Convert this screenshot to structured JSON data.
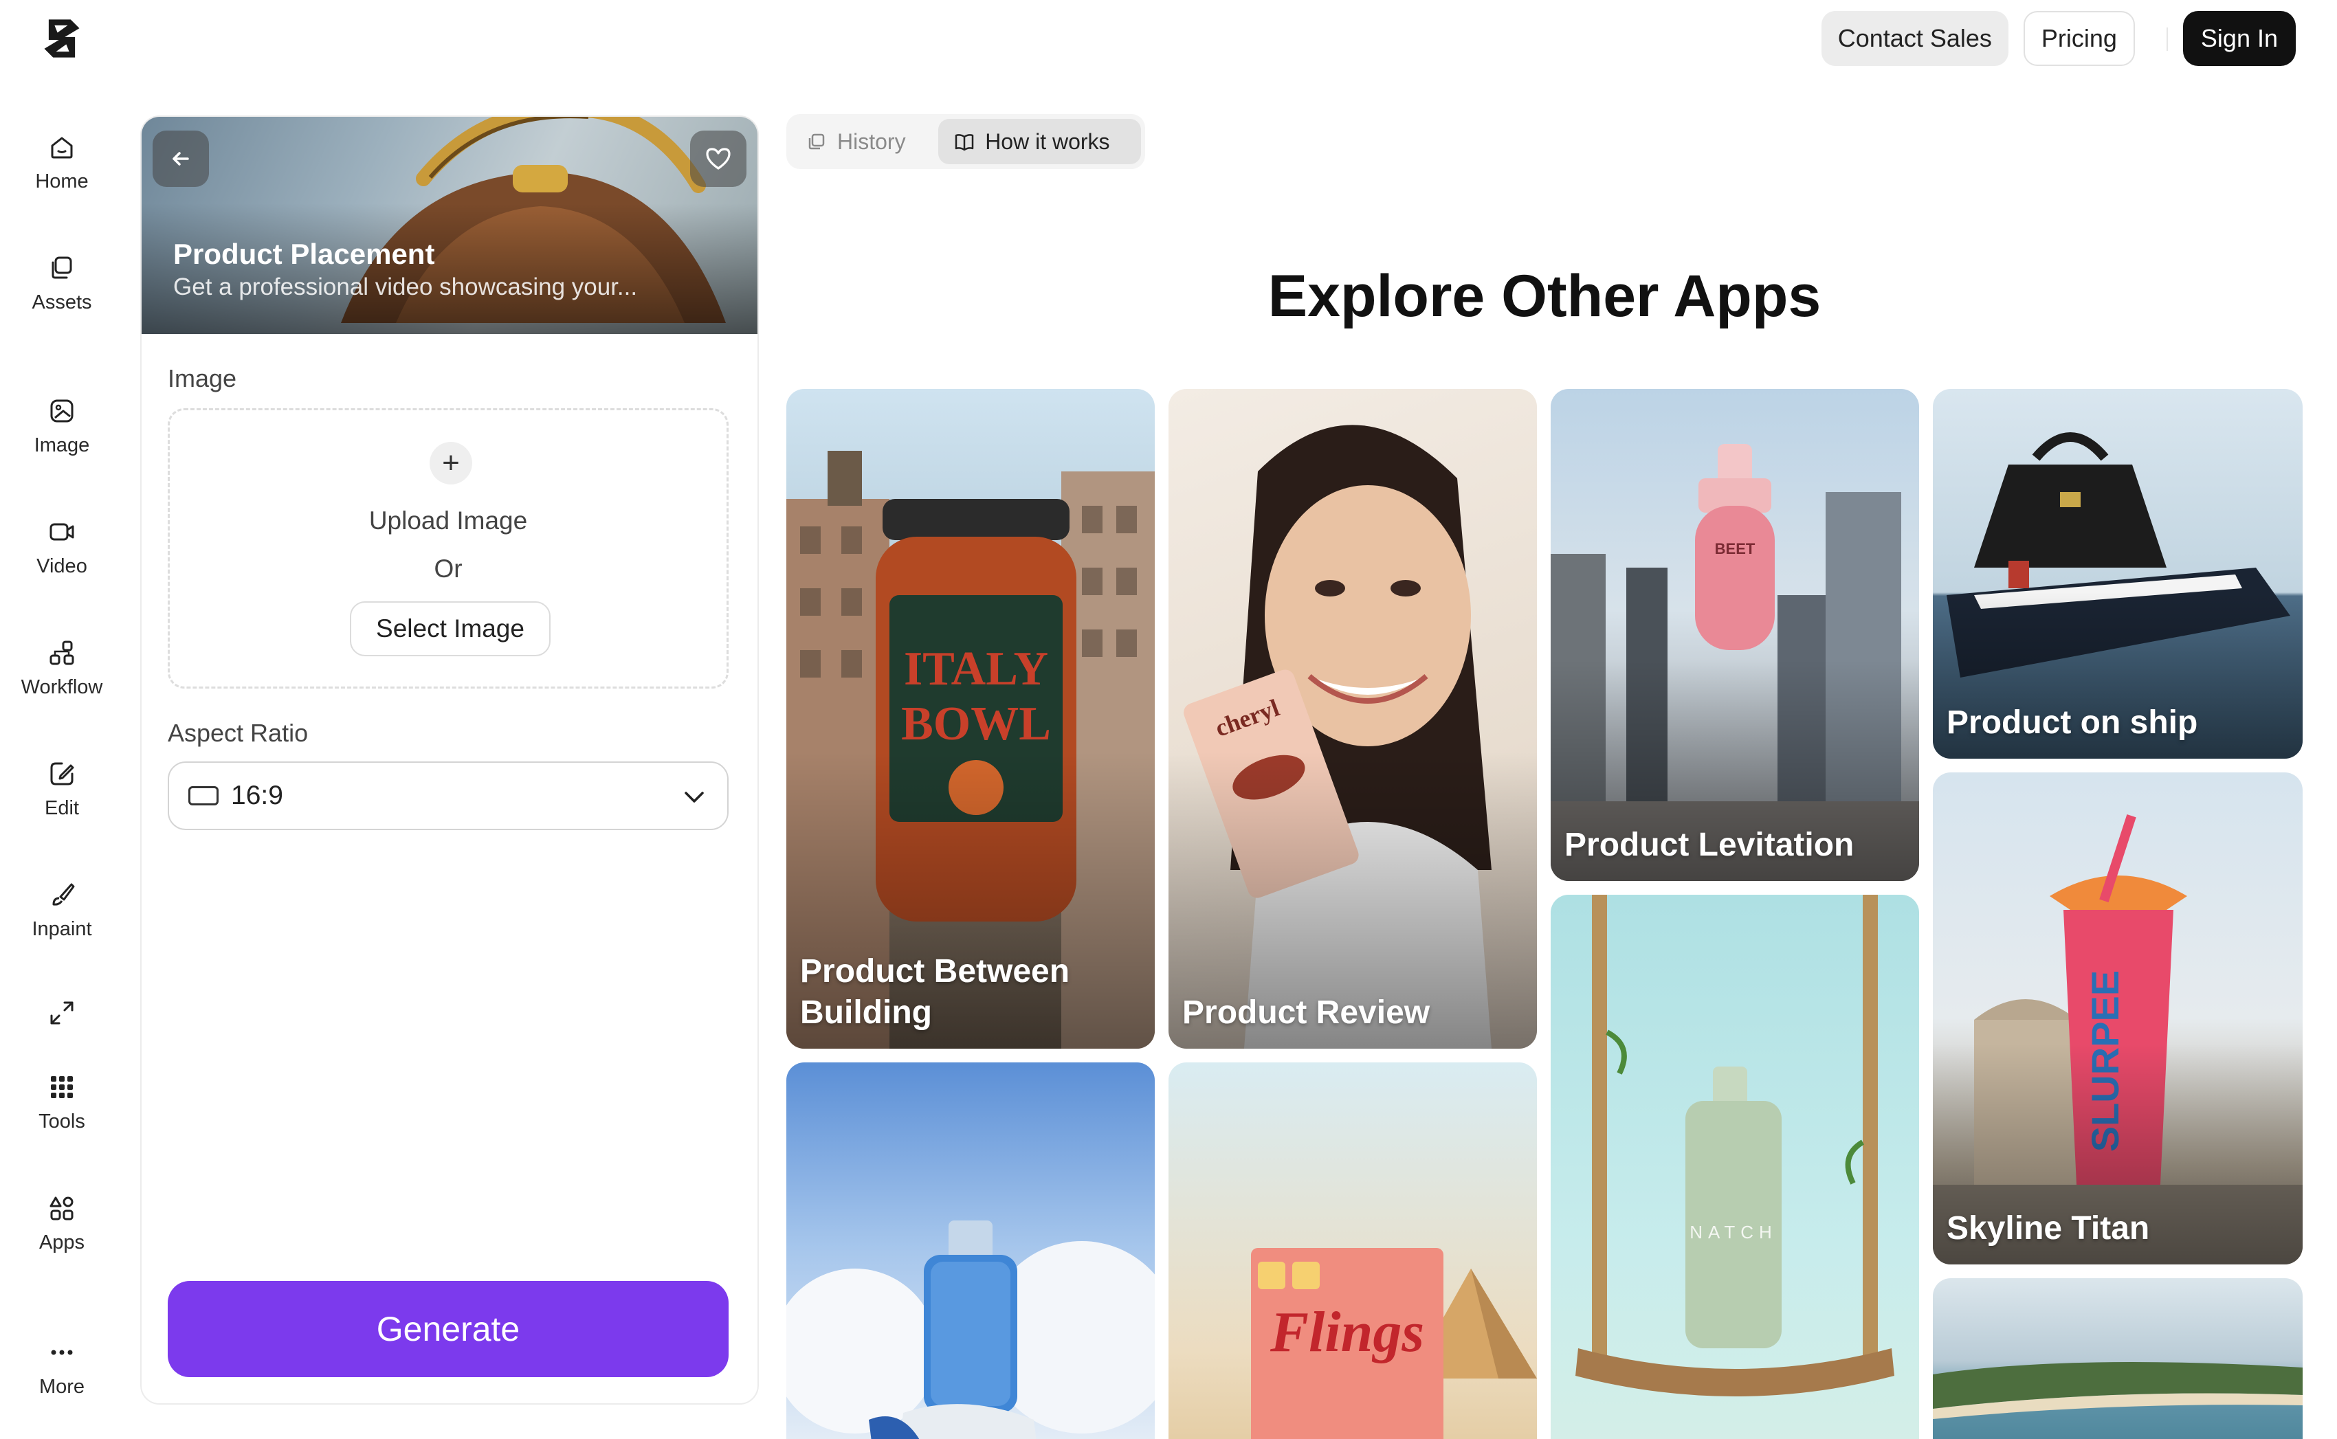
{
  "header": {
    "contact_sales": "Contact Sales",
    "pricing": "Pricing",
    "sign_in": "Sign In"
  },
  "nav": {
    "items": [
      {
        "label": "Home",
        "icon": "home-icon"
      },
      {
        "label": "Assets",
        "icon": "assets-icon"
      },
      {
        "label": "Image",
        "icon": "image-icon"
      },
      {
        "label": "Video",
        "icon": "video-icon"
      },
      {
        "label": "Workflow",
        "icon": "workflow-icon"
      },
      {
        "label": "Edit",
        "icon": "edit-icon"
      },
      {
        "label": "Inpaint",
        "icon": "brush-icon"
      },
      {
        "label": "",
        "icon": "expand-icon"
      },
      {
        "label": "Tools",
        "icon": "grid-icon"
      },
      {
        "label": "Apps",
        "icon": "apps-icon"
      },
      {
        "label": "More",
        "icon": "more-icon"
      }
    ]
  },
  "panel": {
    "title": "Product Placement",
    "subtitle": "Get a professional video showcasing your...",
    "image_label": "Image",
    "upload_label": "Upload Image",
    "or_label": "Or",
    "select_label": "Select  Image",
    "aspect_label": "Aspect Ratio",
    "aspect_value": "16:9",
    "generate_label": "Generate"
  },
  "tabs": {
    "history": "History",
    "how_it_works": "How it works"
  },
  "explore": {
    "title": "Explore Other Apps",
    "cards": [
      {
        "title": "Product Between Building",
        "line1": "Product Between",
        "line2": "Building"
      },
      {
        "title": "Product Review"
      },
      {
        "title": "Product Levitation"
      },
      {
        "title": "Product on ship"
      },
      {
        "title": "Skyline Titan"
      },
      {
        "title": ""
      },
      {
        "title": ""
      },
      {
        "title": ""
      },
      {
        "title": ""
      }
    ]
  },
  "colors": {
    "accent": "#7c3aed",
    "sign_in_bg": "#111111"
  }
}
